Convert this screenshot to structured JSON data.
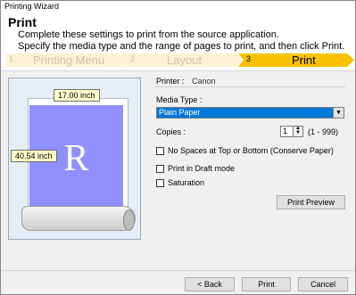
{
  "window": {
    "title": "Printing Wizard"
  },
  "header": {
    "title": "Print",
    "desc_line1": "Complete these settings to print from the source application.",
    "desc_line2": "Specify the media type and the range of pages to print, and then click Print."
  },
  "steps": [
    {
      "num": "1",
      "label": "Printing Menu",
      "state": "done"
    },
    {
      "num": "2",
      "label": "Layout",
      "state": "done"
    },
    {
      "num": "3",
      "label": "Print",
      "state": "active"
    }
  ],
  "preview": {
    "width_label": "17.00 inch",
    "height_label": "40.54 inch",
    "letter": "R"
  },
  "printer": {
    "label": "Printer :",
    "name": "Canon"
  },
  "media_type": {
    "label": "Media Type :",
    "value": "Plain Paper"
  },
  "copies": {
    "label": "Copies :",
    "value": "1",
    "range": "(1 - 999)"
  },
  "options": [
    {
      "label": "No Spaces at Top or Bottom (Conserve Paper)",
      "checked": false
    },
    {
      "label": "Print in Draft mode",
      "checked": false
    },
    {
      "label": "Saturation",
      "checked": false
    }
  ],
  "buttons": {
    "preview": "Print Preview",
    "back": "< Back",
    "print": "Print",
    "cancel": "Cancel"
  },
  "colors": {
    "active_step": "#f8c200",
    "inactive_step": "#fbf1d4",
    "paper": "#8f8fff",
    "preview_bg": "#e5edf7",
    "select_highlight": "#0078d7"
  }
}
